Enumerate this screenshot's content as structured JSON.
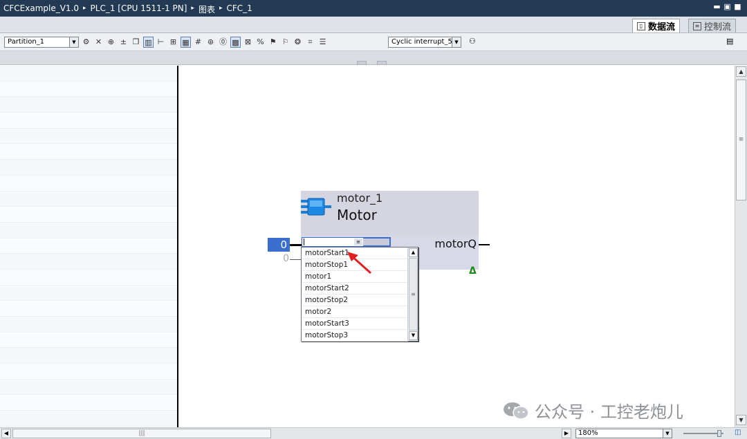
{
  "titlebar": {
    "crumbs": [
      "CFCExample_V1.0",
      "PLC_1 [CPU 1511-1 PN]",
      "图表",
      "CFC_1"
    ],
    "separator": "▸"
  },
  "view_tabs": [
    {
      "label": "数据流",
      "active": true,
      "icon": "dataflow-icon"
    },
    {
      "label": "控制流",
      "active": false,
      "icon": "controlflow-icon"
    }
  ],
  "toolbar": {
    "partition": "Partition_1",
    "task": "Cyclic interrupt_5"
  },
  "block": {
    "instance": "motor_1",
    "type": "Motor",
    "input_value": "0",
    "input_value2": "0",
    "output_pin": "motorQ"
  },
  "dropdown": {
    "items": [
      "motorStart1",
      "motorStop1",
      "motor1",
      "motorStart2",
      "motorStop2",
      "motor2",
      "motorStart3",
      "motorStop3"
    ]
  },
  "statusbar": {
    "zoom": "180%"
  },
  "watermark": {
    "text": "公众号 · 工控老炮儿"
  },
  "colors": {
    "titlebar": "#233a55",
    "selection": "#3a6fd0",
    "block": "#d4d5e0",
    "accent_arrow": "#e02020"
  }
}
